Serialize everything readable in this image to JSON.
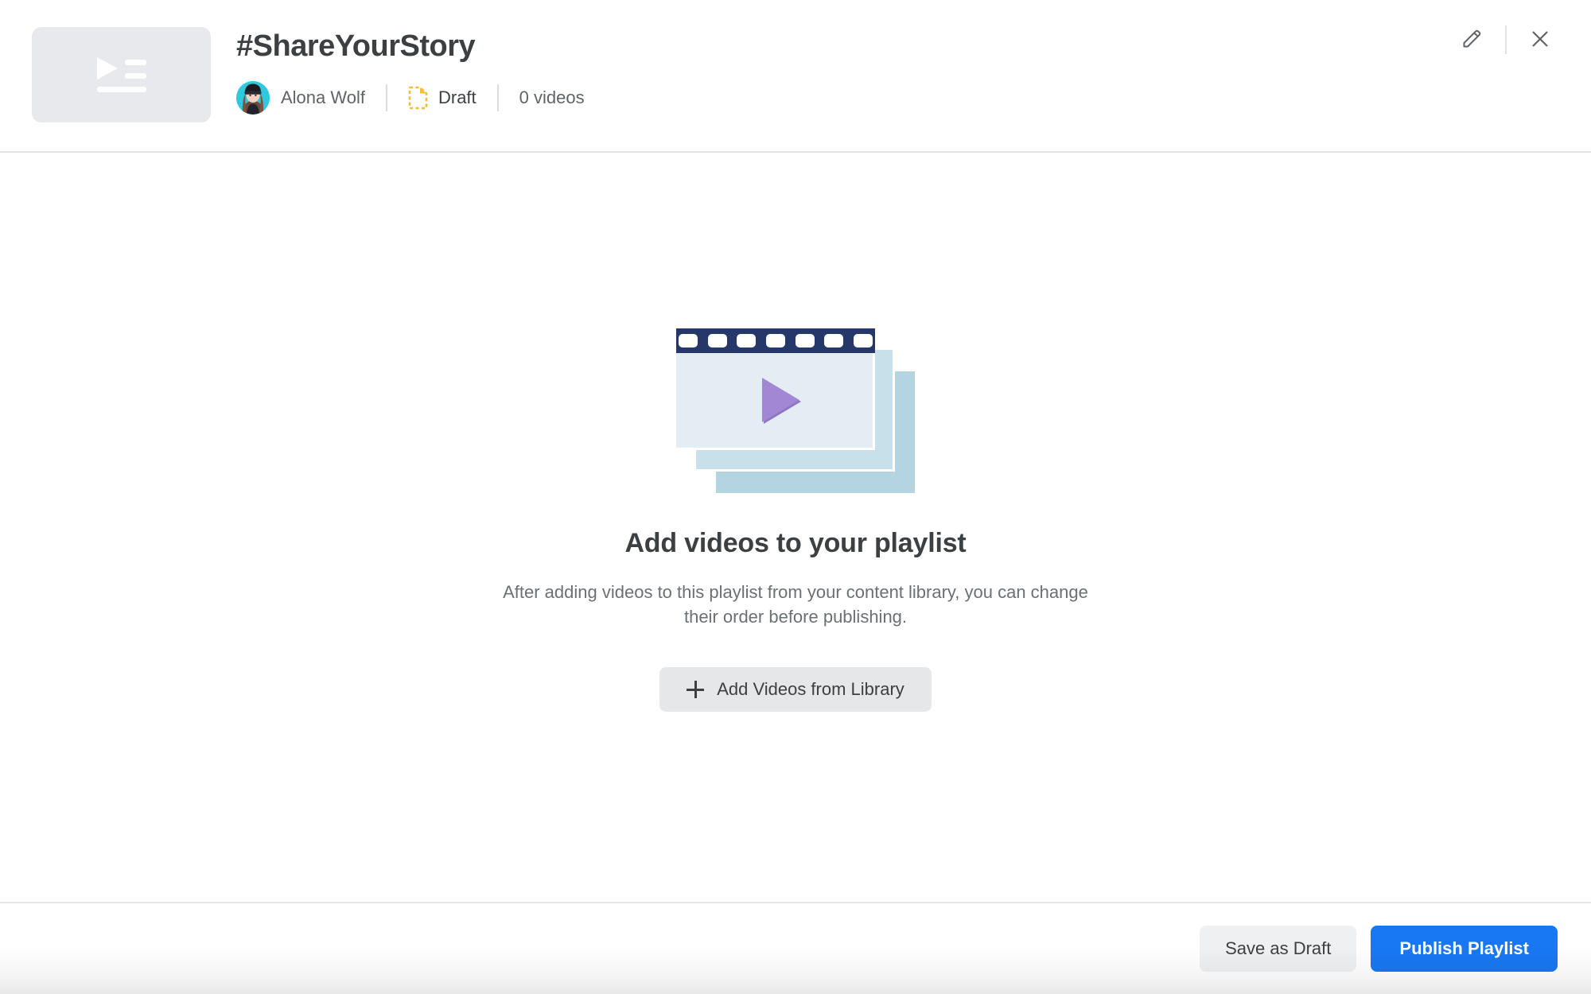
{
  "header": {
    "thumbnail_icon": "playlist-icon",
    "title": "#ShareYourStory",
    "owner": {
      "name": "Alona Wolf",
      "avatar_alt": "Alona Wolf avatar"
    },
    "status": {
      "icon": "draft-document-icon",
      "label": "Draft",
      "color": "#f5bb3c"
    },
    "video_count_label": "0 videos",
    "actions": {
      "edit_label": "Edit",
      "edit_icon": "pencil-icon",
      "close_label": "Close",
      "close_icon": "close-icon"
    }
  },
  "empty_state": {
    "illustration": "film-strip-stack-icon",
    "title": "Add videos to your playlist",
    "description": "After adding videos to this playlist from your content library, you can change their order before publishing.",
    "add_button_label": "Add Videos from Library",
    "add_button_icon": "plus-icon"
  },
  "footer": {
    "save_draft_label": "Save as Draft",
    "publish_label": "Publish Playlist",
    "primary_color": "#1877f2"
  }
}
